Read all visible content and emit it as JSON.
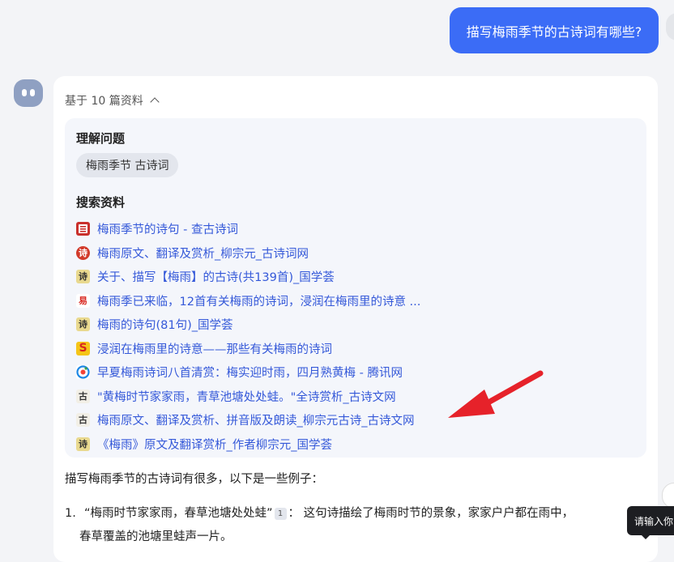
{
  "user_message": "描写梅雨季节的古诗词有哪些?",
  "sources_header": "基于 10 篇资料",
  "understand": {
    "title": "理解问题",
    "keyword": "梅雨季节 古诗词"
  },
  "search": {
    "title": "搜索资料",
    "results": [
      {
        "title": "梅雨季节的诗句 - 查古诗词",
        "icon": "book-icon",
        "glyph": "",
        "bg": "#c9302c"
      },
      {
        "title": "梅雨原文、翻译及赏析_柳宗元_古诗词网",
        "icon": "seal-icon",
        "glyph": "诗",
        "bg": "#d23a2a"
      },
      {
        "title": "关于、描写【梅雨】的古诗(共139首)_国学荟",
        "icon": "shi-icon",
        "glyph": "诗",
        "bg": "#e9d98f"
      },
      {
        "title": "梅雨季已来临，12首有关梅雨的诗词，浸润在梅雨里的诗意 ...",
        "icon": "sohu-icon",
        "glyph": "易",
        "bg": "#ffffff"
      },
      {
        "title": "梅雨的诗句(81句)_国学荟",
        "icon": "shi-icon",
        "glyph": "诗",
        "bg": "#e9d98f"
      },
      {
        "title": "浸润在梅雨里的诗意——那些有关梅雨的诗词",
        "icon": "s-logo-icon",
        "glyph": "S",
        "bg": "#f5c518"
      },
      {
        "title": "早夏梅雨诗词八首清赏：梅实迎时雨，四月熟黄梅 - 腾讯网",
        "icon": "tencent-icon",
        "glyph": "",
        "bg": "#ffffff"
      },
      {
        "title": "\"黄梅时节家家雨，青草池塘处处蛙。\"全诗赏析_古诗文网",
        "icon": "gu-icon",
        "glyph": "古",
        "bg": "#f2efe6"
      },
      {
        "title": "梅雨原文、翻译及赏析、拼音版及朗读_柳宗元古诗_古诗文网",
        "icon": "gu-icon",
        "glyph": "古",
        "bg": "#f2efe6"
      },
      {
        "title": "《梅雨》原文及翻译赏析_作者柳宗元_国学荟",
        "icon": "shi-icon",
        "glyph": "诗",
        "bg": "#e9d98f"
      }
    ]
  },
  "answer": {
    "intro": "描写梅雨季节的古诗词有很多，以下是一些例子：",
    "items": [
      {
        "num": "1.",
        "quote": "“梅雨时节家家雨，春草池塘处处蛙”",
        "cite": "1",
        "text_line1": "：  这句诗描绘了梅雨时节的景象，家家户户都在雨中，",
        "text_line2": "春草覆盖的池塘里蛙声一片。"
      }
    ]
  },
  "tooltip": "请输入你",
  "colors": {
    "accent": "#3b6cf6",
    "link": "#3559d9",
    "arrow": "#e6222a"
  }
}
